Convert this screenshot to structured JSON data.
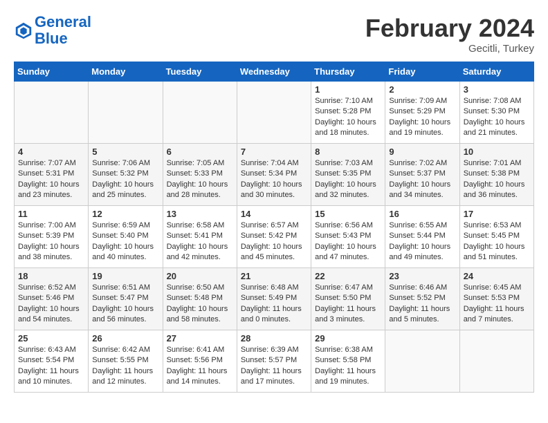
{
  "header": {
    "logo_line1": "General",
    "logo_line2": "Blue",
    "month_title": "February 2024",
    "location": "Gecitli, Turkey"
  },
  "days_of_week": [
    "Sunday",
    "Monday",
    "Tuesday",
    "Wednesday",
    "Thursday",
    "Friday",
    "Saturday"
  ],
  "weeks": [
    [
      {
        "day": "",
        "info": ""
      },
      {
        "day": "",
        "info": ""
      },
      {
        "day": "",
        "info": ""
      },
      {
        "day": "",
        "info": ""
      },
      {
        "day": "1",
        "info": "Sunrise: 7:10 AM\nSunset: 5:28 PM\nDaylight: 10 hours\nand 18 minutes."
      },
      {
        "day": "2",
        "info": "Sunrise: 7:09 AM\nSunset: 5:29 PM\nDaylight: 10 hours\nand 19 minutes."
      },
      {
        "day": "3",
        "info": "Sunrise: 7:08 AM\nSunset: 5:30 PM\nDaylight: 10 hours\nand 21 minutes."
      }
    ],
    [
      {
        "day": "4",
        "info": "Sunrise: 7:07 AM\nSunset: 5:31 PM\nDaylight: 10 hours\nand 23 minutes."
      },
      {
        "day": "5",
        "info": "Sunrise: 7:06 AM\nSunset: 5:32 PM\nDaylight: 10 hours\nand 25 minutes."
      },
      {
        "day": "6",
        "info": "Sunrise: 7:05 AM\nSunset: 5:33 PM\nDaylight: 10 hours\nand 28 minutes."
      },
      {
        "day": "7",
        "info": "Sunrise: 7:04 AM\nSunset: 5:34 PM\nDaylight: 10 hours\nand 30 minutes."
      },
      {
        "day": "8",
        "info": "Sunrise: 7:03 AM\nSunset: 5:35 PM\nDaylight: 10 hours\nand 32 minutes."
      },
      {
        "day": "9",
        "info": "Sunrise: 7:02 AM\nSunset: 5:37 PM\nDaylight: 10 hours\nand 34 minutes."
      },
      {
        "day": "10",
        "info": "Sunrise: 7:01 AM\nSunset: 5:38 PM\nDaylight: 10 hours\nand 36 minutes."
      }
    ],
    [
      {
        "day": "11",
        "info": "Sunrise: 7:00 AM\nSunset: 5:39 PM\nDaylight: 10 hours\nand 38 minutes."
      },
      {
        "day": "12",
        "info": "Sunrise: 6:59 AM\nSunset: 5:40 PM\nDaylight: 10 hours\nand 40 minutes."
      },
      {
        "day": "13",
        "info": "Sunrise: 6:58 AM\nSunset: 5:41 PM\nDaylight: 10 hours\nand 42 minutes."
      },
      {
        "day": "14",
        "info": "Sunrise: 6:57 AM\nSunset: 5:42 PM\nDaylight: 10 hours\nand 45 minutes."
      },
      {
        "day": "15",
        "info": "Sunrise: 6:56 AM\nSunset: 5:43 PM\nDaylight: 10 hours\nand 47 minutes."
      },
      {
        "day": "16",
        "info": "Sunrise: 6:55 AM\nSunset: 5:44 PM\nDaylight: 10 hours\nand 49 minutes."
      },
      {
        "day": "17",
        "info": "Sunrise: 6:53 AM\nSunset: 5:45 PM\nDaylight: 10 hours\nand 51 minutes."
      }
    ],
    [
      {
        "day": "18",
        "info": "Sunrise: 6:52 AM\nSunset: 5:46 PM\nDaylight: 10 hours\nand 54 minutes."
      },
      {
        "day": "19",
        "info": "Sunrise: 6:51 AM\nSunset: 5:47 PM\nDaylight: 10 hours\nand 56 minutes."
      },
      {
        "day": "20",
        "info": "Sunrise: 6:50 AM\nSunset: 5:48 PM\nDaylight: 10 hours\nand 58 minutes."
      },
      {
        "day": "21",
        "info": "Sunrise: 6:48 AM\nSunset: 5:49 PM\nDaylight: 11 hours\nand 0 minutes."
      },
      {
        "day": "22",
        "info": "Sunrise: 6:47 AM\nSunset: 5:50 PM\nDaylight: 11 hours\nand 3 minutes."
      },
      {
        "day": "23",
        "info": "Sunrise: 6:46 AM\nSunset: 5:52 PM\nDaylight: 11 hours\nand 5 minutes."
      },
      {
        "day": "24",
        "info": "Sunrise: 6:45 AM\nSunset: 5:53 PM\nDaylight: 11 hours\nand 7 minutes."
      }
    ],
    [
      {
        "day": "25",
        "info": "Sunrise: 6:43 AM\nSunset: 5:54 PM\nDaylight: 11 hours\nand 10 minutes."
      },
      {
        "day": "26",
        "info": "Sunrise: 6:42 AM\nSunset: 5:55 PM\nDaylight: 11 hours\nand 12 minutes."
      },
      {
        "day": "27",
        "info": "Sunrise: 6:41 AM\nSunset: 5:56 PM\nDaylight: 11 hours\nand 14 minutes."
      },
      {
        "day": "28",
        "info": "Sunrise: 6:39 AM\nSunset: 5:57 PM\nDaylight: 11 hours\nand 17 minutes."
      },
      {
        "day": "29",
        "info": "Sunrise: 6:38 AM\nSunset: 5:58 PM\nDaylight: 11 hours\nand 19 minutes."
      },
      {
        "day": "",
        "info": ""
      },
      {
        "day": "",
        "info": ""
      }
    ]
  ]
}
